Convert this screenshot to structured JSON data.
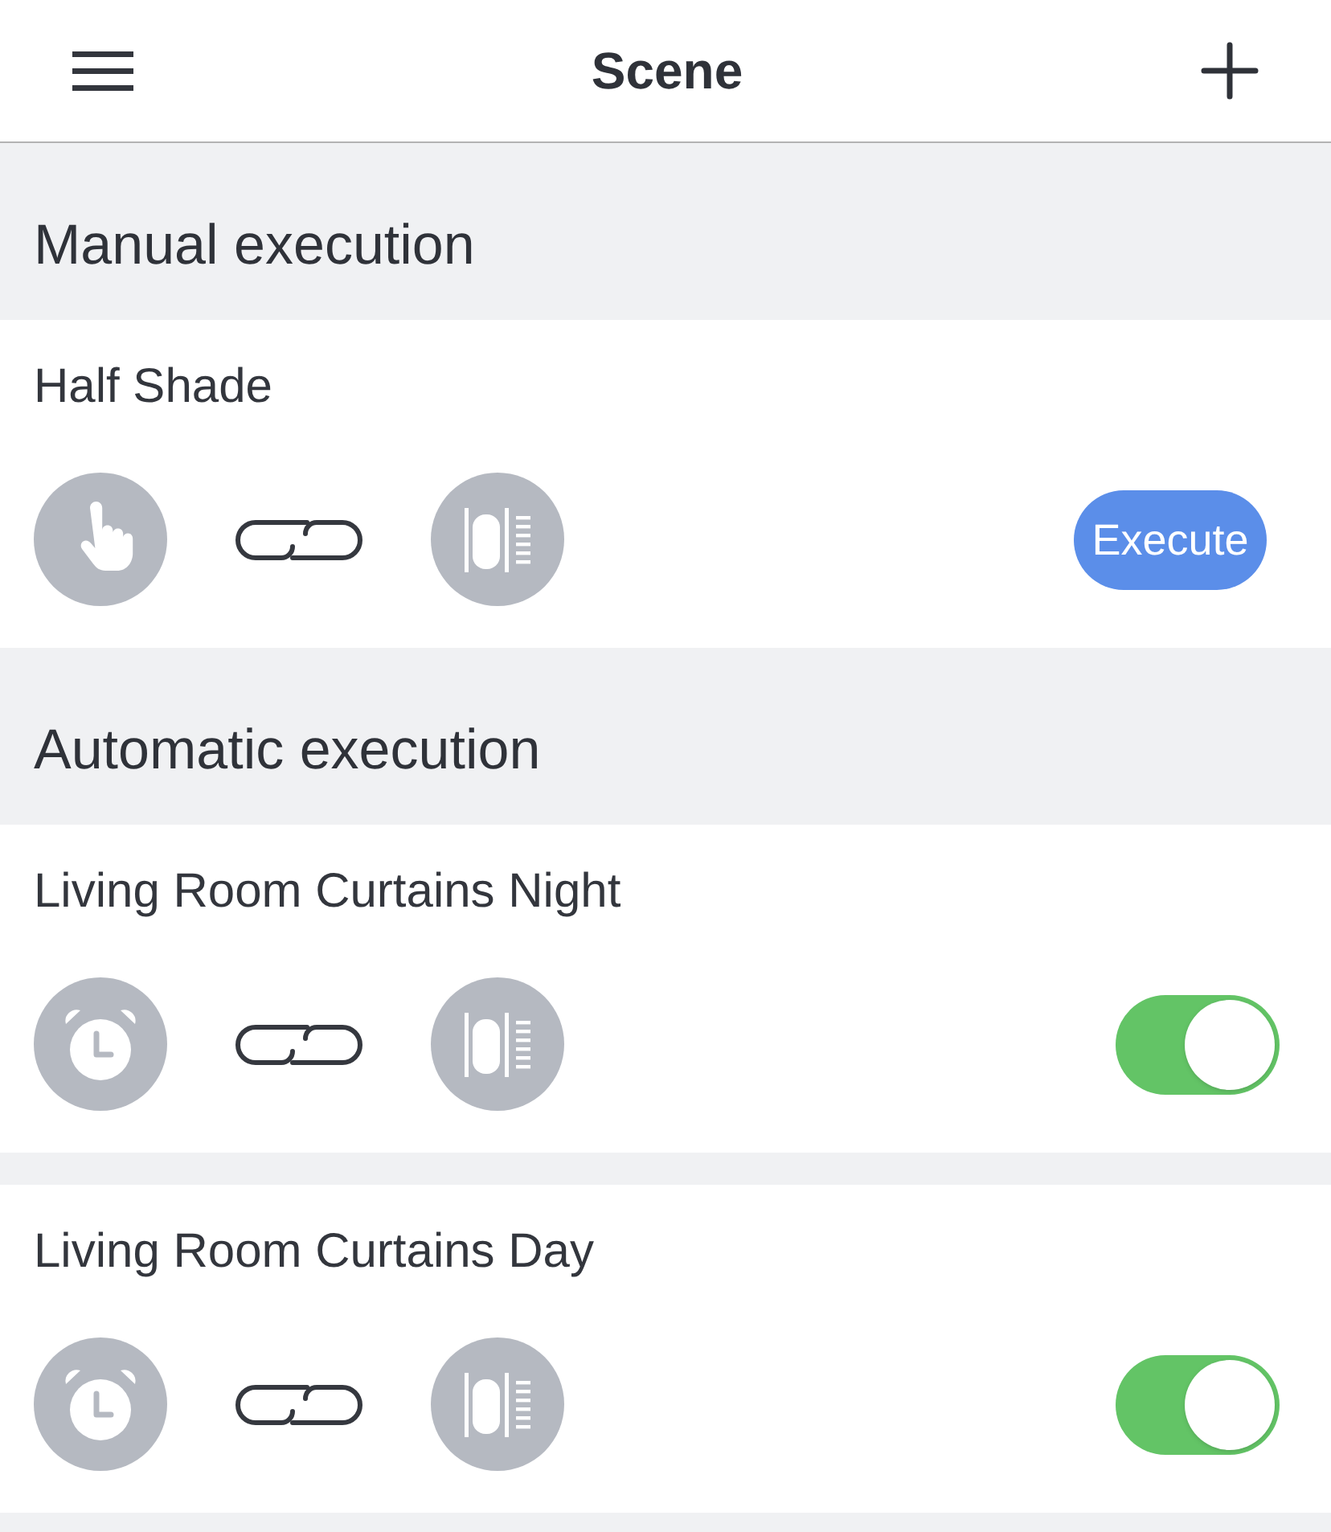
{
  "header": {
    "title": "Scene"
  },
  "sections": [
    {
      "title": "Manual execution",
      "scenes": [
        {
          "kind": "manual",
          "name": "Half Shade",
          "button": "Execute"
        }
      ]
    },
    {
      "title": "Automatic execution",
      "scenes": [
        {
          "kind": "automatic",
          "name": "Living Room Curtains Night",
          "on": true
        },
        {
          "kind": "automatic",
          "name": "Living Room Curtains Day",
          "on": true
        }
      ]
    }
  ]
}
